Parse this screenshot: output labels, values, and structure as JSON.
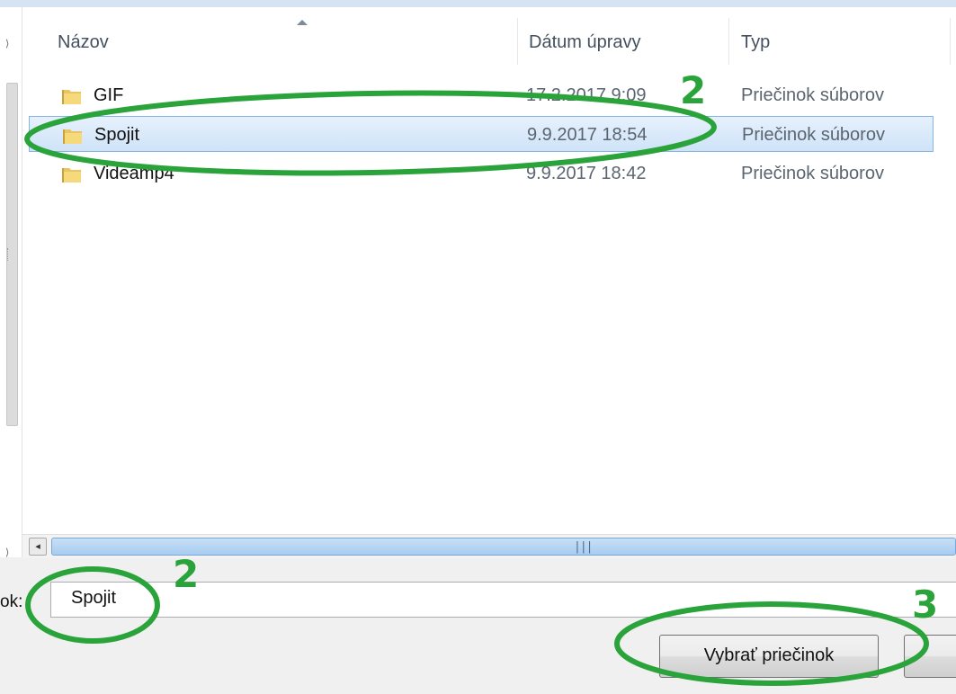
{
  "columns": {
    "name": "Názov",
    "date": "Dátum úpravy",
    "type": "Typ"
  },
  "rows": [
    {
      "name": "GIF",
      "date": "17.2.2017 9:09",
      "type": "Priečinok súborov"
    },
    {
      "name": "Spojit",
      "date": "9.9.2017 18:54",
      "type": "Priečinok súborov"
    },
    {
      "name": "Videamp4",
      "date": "9.9.2017 18:42",
      "type": "Priečinok súborov"
    }
  ],
  "filename": {
    "label": "ok:",
    "value": "Spojit"
  },
  "buttons": {
    "select": "Vybrať priečinok"
  },
  "annotations": {
    "a": "2",
    "b": "2",
    "c": "3"
  },
  "colors": {
    "annotation": "#2aa33a",
    "selection_border": "#86b4e6"
  },
  "icons": {
    "folder": "folder-icon",
    "sort": "sort-ascending-icon",
    "scroll_left": "scroll-left-arrow-icon"
  }
}
